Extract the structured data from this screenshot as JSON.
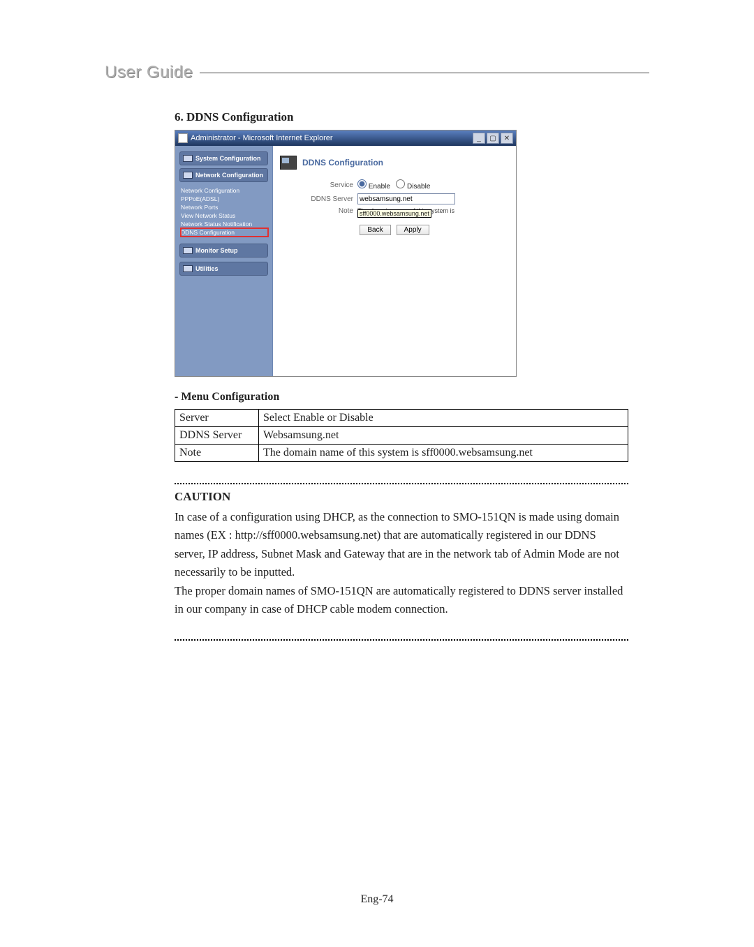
{
  "header": {
    "title": "User Guide"
  },
  "section": {
    "number_title": "6. DDNS Configuration"
  },
  "ie": {
    "title": "Administrator - Microsoft Internet Explorer",
    "win_min": "_",
    "win_max": "▢",
    "win_close": "✕",
    "sidebar": {
      "top": [
        "System Configuration",
        "Network Configuration"
      ],
      "links": [
        "Network Configuration",
        "PPPoE(ADSL)",
        "Network Ports",
        "View Network Status",
        "Network Status Notification",
        "DDNS Configuration"
      ],
      "selected_link_index": 5,
      "bottom": [
        "Monitor Setup",
        "Utilities"
      ]
    },
    "main": {
      "title": "DDNS Configuration",
      "rows": {
        "service_label": "Service",
        "enable_label": "Enable",
        "disable_label": "Disable",
        "ddns_server_label": "DDNS Server",
        "ddns_server_value": "websamsung.net",
        "note_label": "Note",
        "note_text": "The domain name of this system is",
        "tooltip": "sff0000.websamsung.net"
      },
      "buttons": {
        "back": "Back",
        "apply": "Apply"
      }
    }
  },
  "menu_config": {
    "title": "- Menu Configuration",
    "rows": [
      {
        "k": "Server",
        "v": "Select Enable or Disable"
      },
      {
        "k": "DDNS Server",
        "v": "Websamsung.net"
      },
      {
        "k": "Note",
        "v": "The domain name of this system is sff0000.websamsung.net"
      }
    ]
  },
  "caution": {
    "heading": "CAUTION",
    "p1": "In case of a configuration using DHCP, as the connection to SMO-151QN is made using domain names (EX : http://sff0000.websamsung.net) that are automatically registered in our DDNS server, IP address, Subnet Mask and Gateway that are in the network tab of Admin Mode are not necessarily to be inputted.",
    "p2": "The proper domain names of SMO-151QN are automatically registered to DDNS server installed in our company in case of DHCP cable modem connection."
  },
  "page_number": "Eng-74"
}
